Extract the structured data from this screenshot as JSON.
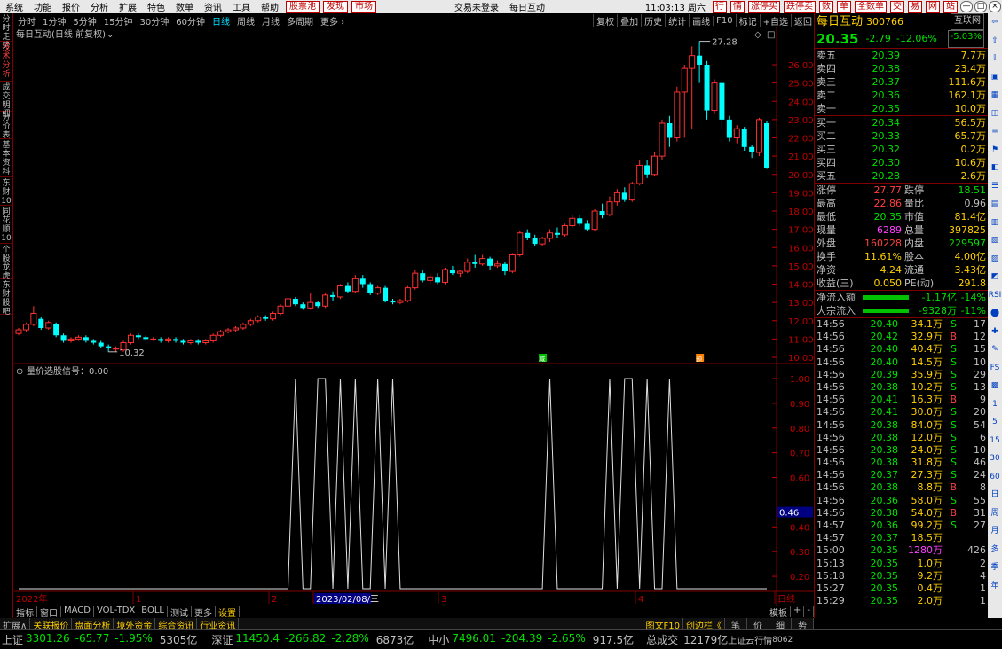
{
  "menu": {
    "items": [
      "系统",
      "功能",
      "报价",
      "分析",
      "扩展",
      "特色",
      "数单",
      "资讯",
      "工具",
      "帮助"
    ],
    "red_items": [
      "股票池",
      "发现",
      "市场"
    ],
    "center": "交易未登录",
    "stock": "每日互动",
    "time": "11:03:13 周六",
    "right_items": [
      "行",
      "情",
      "涨停买",
      "跌停卖",
      "数",
      "单",
      "全数单",
      "交",
      "易",
      "网",
      "站"
    ]
  },
  "periods": [
    "分时",
    "1分钟",
    "5分钟",
    "15分钟",
    "30分钟",
    "60分钟",
    "日线",
    "周线",
    "月线",
    "多周期",
    "更多 ›"
  ],
  "active_period": "日线",
  "tools": [
    "复权",
    "叠加",
    "历史",
    "统计",
    "画线",
    "F10",
    "标记",
    "+自选",
    "返回"
  ],
  "leftnav": [
    "分时走势",
    "技术分析",
    "成交明细",
    "分价表",
    "基本资料",
    "东财10",
    "同花顺10",
    "个股龙虎",
    "东财股吧"
  ],
  "chart_title": "每日互动(日线 前复权)",
  "chart_data": {
    "type": "candlestick",
    "price_axis": {
      "min": 10.0,
      "max": 26.0,
      "ticks": [
        "26.00",
        "25.00",
        "24.00",
        "23.00",
        "22.00",
        "21.00",
        "20.00",
        "19.00",
        "18.00",
        "17.00",
        "16.00",
        "15.00",
        "14.00",
        "13.00",
        "12.00",
        "11.00",
        "10.00"
      ]
    },
    "high_label": "27.28",
    "low_label": "10.32",
    "candles": [
      [
        11.3,
        11.5,
        11.2,
        11.6
      ],
      [
        11.5,
        11.8,
        11.4,
        11.9
      ],
      [
        11.8,
        12.4,
        11.7,
        12.8
      ],
      [
        12.1,
        11.6,
        11.5,
        12.2
      ],
      [
        11.6,
        11.9,
        11.5,
        12.0
      ],
      [
        11.8,
        11.2,
        11.1,
        11.9
      ],
      [
        11.2,
        10.9,
        10.8,
        11.3
      ],
      [
        10.9,
        11.0,
        10.8,
        11.1
      ],
      [
        11.0,
        11.1,
        10.9,
        11.2
      ],
      [
        11.1,
        10.9,
        10.8,
        11.2
      ],
      [
        10.9,
        10.8,
        10.7,
        11.0
      ],
      [
        10.8,
        10.6,
        10.5,
        10.9
      ],
      [
        10.6,
        10.5,
        10.3,
        10.7
      ],
      [
        10.5,
        10.5,
        10.3,
        10.6
      ],
      [
        10.4,
        10.8,
        10.3,
        10.9
      ],
      [
        10.8,
        11.2,
        10.7,
        11.3
      ],
      [
        11.2,
        11.1,
        11.0,
        11.3
      ],
      [
        11.1,
        11.0,
        10.9,
        11.2
      ],
      [
        11.0,
        11.0,
        10.9,
        11.1
      ],
      [
        11.0,
        10.9,
        10.8,
        11.1
      ],
      [
        10.9,
        11.0,
        10.8,
        11.1
      ],
      [
        11.0,
        10.9,
        10.8,
        11.1
      ],
      [
        10.9,
        10.8,
        10.7,
        11.0
      ],
      [
        10.8,
        10.9,
        10.7,
        11.0
      ],
      [
        10.9,
        10.8,
        10.7,
        11.0
      ],
      [
        10.8,
        10.9,
        10.7,
        11.0
      ],
      [
        10.9,
        11.2,
        10.8,
        11.3
      ],
      [
        11.2,
        11.4,
        11.1,
        11.5
      ],
      [
        11.4,
        11.5,
        11.3,
        11.6
      ],
      [
        11.5,
        11.6,
        11.4,
        11.7
      ],
      [
        11.6,
        11.8,
        11.5,
        11.9
      ],
      [
        11.8,
        12.0,
        11.7,
        12.1
      ],
      [
        12.0,
        12.2,
        11.9,
        12.3
      ],
      [
        12.2,
        12.1,
        12.0,
        12.3
      ],
      [
        12.1,
        12.4,
        12.0,
        12.5
      ],
      [
        12.4,
        12.8,
        12.3,
        12.9
      ],
      [
        12.8,
        13.2,
        12.7,
        13.3
      ],
      [
        13.2,
        12.9,
        12.8,
        13.3
      ],
      [
        12.9,
        12.7,
        12.6,
        13.0
      ],
      [
        12.7,
        13.0,
        12.6,
        13.5
      ],
      [
        13.0,
        12.8,
        12.7,
        13.1
      ],
      [
        12.8,
        13.4,
        12.7,
        13.5
      ],
      [
        13.4,
        13.3,
        13.1,
        13.6
      ],
      [
        13.3,
        13.9,
        13.2,
        14.0
      ],
      [
        13.9,
        13.6,
        13.5,
        14.1
      ],
      [
        13.6,
        14.3,
        13.5,
        14.5
      ],
      [
        14.3,
        14.0,
        13.8,
        14.5
      ],
      [
        14.0,
        13.5,
        13.4,
        14.1
      ],
      [
        13.5,
        13.8,
        13.4,
        13.9
      ],
      [
        13.8,
        13.1,
        13.0,
        13.9
      ],
      [
        13.1,
        13.0,
        12.9,
        13.2
      ],
      [
        13.0,
        13.1,
        12.9,
        13.2
      ],
      [
        13.1,
        13.8,
        13.0,
        13.9
      ],
      [
        13.8,
        14.6,
        13.7,
        14.8
      ],
      [
        14.6,
        14.2,
        14.1,
        14.8
      ],
      [
        14.2,
        14.4,
        14.0,
        14.6
      ],
      [
        14.4,
        14.1,
        14.0,
        14.6
      ],
      [
        14.1,
        14.8,
        14.0,
        14.9
      ],
      [
        14.8,
        14.6,
        14.5,
        15.0
      ],
      [
        14.6,
        14.7,
        14.4,
        14.8
      ],
      [
        14.7,
        15.2,
        14.6,
        15.4
      ],
      [
        15.2,
        15.1,
        14.9,
        15.6
      ],
      [
        15.1,
        15.4,
        15.0,
        15.6
      ],
      [
        15.4,
        15.0,
        14.8,
        15.5
      ],
      [
        15.0,
        15.1,
        14.9,
        15.3
      ],
      [
        15.1,
        14.7,
        14.5,
        15.2
      ],
      [
        14.7,
        15.6,
        14.6,
        15.7
      ],
      [
        15.6,
        16.8,
        15.5,
        16.9
      ],
      [
        16.8,
        16.5,
        16.4,
        17.0
      ],
      [
        16.5,
        16.2,
        16.1,
        16.7
      ],
      [
        16.2,
        16.5,
        16.1,
        16.6
      ],
      [
        16.5,
        16.8,
        16.3,
        17.0
      ],
      [
        16.8,
        16.7,
        16.5,
        17.1
      ],
      [
        16.7,
        17.2,
        16.6,
        17.3
      ],
      [
        17.2,
        17.6,
        17.1,
        17.8
      ],
      [
        17.6,
        17.3,
        17.2,
        17.8
      ],
      [
        17.3,
        17.0,
        16.9,
        17.5
      ],
      [
        17.0,
        18.0,
        16.9,
        18.1
      ],
      [
        18.0,
        17.8,
        17.6,
        18.4
      ],
      [
        17.8,
        18.5,
        17.7,
        18.8
      ],
      [
        18.5,
        19.0,
        18.3,
        19.2
      ],
      [
        19.0,
        18.6,
        18.5,
        19.3
      ],
      [
        18.6,
        19.5,
        18.5,
        19.6
      ],
      [
        19.5,
        20.5,
        19.4,
        20.8
      ],
      [
        20.5,
        20.0,
        19.8,
        20.8
      ],
      [
        20.0,
        21.0,
        19.9,
        21.2
      ],
      [
        21.0,
        22.8,
        20.8,
        23.0
      ],
      [
        22.8,
        22.0,
        21.5,
        23.2
      ],
      [
        22.0,
        24.5,
        21.8,
        24.8
      ],
      [
        24.5,
        25.8,
        22.0,
        26.0
      ],
      [
        25.8,
        26.5,
        22.5,
        27.0
      ],
      [
        26.5,
        26.0,
        25.0,
        27.28
      ],
      [
        26.0,
        23.5,
        23.0,
        26.2
      ],
      [
        23.5,
        25.0,
        23.3,
        25.2
      ],
      [
        25.0,
        23.0,
        22.5,
        25.1
      ],
      [
        23.0,
        22.0,
        21.8,
        23.2
      ],
      [
        22.0,
        22.5,
        21.7,
        22.7
      ],
      [
        22.5,
        21.5,
        21.3,
        22.6
      ],
      [
        21.5,
        21.2,
        20.9,
        21.6
      ],
      [
        21.2,
        23.0,
        21.0,
        23.1
      ],
      [
        22.8,
        20.35,
        20.3,
        22.9
      ]
    ],
    "indicator_title": "量价选股信号：0.00",
    "indicator_axis": {
      "ticks": [
        "1.00",
        "0.90",
        "0.80",
        "0.70",
        "0.60",
        "0.46",
        "0.40",
        "0.30",
        "0.20"
      ]
    },
    "signal_candles": [
      37,
      40,
      41,
      43,
      45,
      48,
      50,
      71,
      79,
      81,
      82,
      84,
      87
    ],
    "x_labels": [
      "2022年",
      "1",
      "2",
      "2023/02/08/三",
      "3",
      "4",
      "日线"
    ]
  },
  "quote": {
    "name": "每日互动",
    "code": "300766",
    "tag": "互联网",
    "price": "20.35",
    "change": "-2.79",
    "pct": "-12.06%",
    "small_pct": "-5.03%"
  },
  "asks": [
    [
      "卖五",
      "20.39",
      "7.7万"
    ],
    [
      "卖四",
      "20.38",
      "23.4万"
    ],
    [
      "卖三",
      "20.37",
      "111.6万"
    ],
    [
      "卖二",
      "20.36",
      "162.1万"
    ],
    [
      "卖一",
      "20.35",
      "10.0万"
    ]
  ],
  "bids": [
    [
      "买一",
      "20.34",
      "56.5万"
    ],
    [
      "买二",
      "20.33",
      "65.7万"
    ],
    [
      "买三",
      "20.32",
      "0.2万"
    ],
    [
      "买四",
      "20.30",
      "10.6万"
    ],
    [
      "买五",
      "20.28",
      "2.6万"
    ]
  ],
  "stats": [
    [
      "涨停",
      "27.77",
      "跌停",
      "18.51"
    ],
    [
      "最高",
      "22.86",
      "量比",
      "0.96"
    ],
    [
      "最低",
      "20.35",
      "市值",
      "81.4亿"
    ],
    [
      "现量",
      "6289",
      "总量",
      "397825"
    ],
    [
      "外盘",
      "160228",
      "内盘",
      "229597"
    ],
    [
      "换手",
      "11.61%",
      "股本",
      "4.00亿"
    ],
    [
      "净资",
      "4.24",
      "流通",
      "3.43亿"
    ],
    [
      "收益(三)",
      "0.050",
      "PE(动)",
      "291.8"
    ]
  ],
  "flows": [
    [
      "净流入额",
      "-1.17亿",
      "-14%"
    ],
    [
      "大宗流入",
      "-9328万",
      "-11%"
    ]
  ],
  "ticks": [
    [
      "14:56",
      "20.40",
      "34.1万",
      "S",
      "17"
    ],
    [
      "14:56",
      "20.42",
      "32.9万",
      "B",
      "12"
    ],
    [
      "14:56",
      "20.40",
      "40.4万",
      "S",
      "15"
    ],
    [
      "14:56",
      "20.40",
      "14.5万",
      "S",
      "10"
    ],
    [
      "14:56",
      "20.39",
      "35.9万",
      "S",
      "29"
    ],
    [
      "14:56",
      "20.38",
      "10.2万",
      "S",
      "13"
    ],
    [
      "14:56",
      "20.41",
      "16.3万",
      "B",
      "9"
    ],
    [
      "14:56",
      "20.41",
      "30.0万",
      "S",
      "20"
    ],
    [
      "14:56",
      "20.38",
      "84.0万",
      "S",
      "54"
    ],
    [
      "14:56",
      "20.38",
      "12.0万",
      "S",
      "6"
    ],
    [
      "14:56",
      "20.38",
      "24.0万",
      "S",
      "10"
    ],
    [
      "14:56",
      "20.38",
      "31.8万",
      "S",
      "46"
    ],
    [
      "14:56",
      "20.37",
      "27.3万",
      "S",
      "24"
    ],
    [
      "14:56",
      "20.38",
      "8.8万",
      "B",
      "8"
    ],
    [
      "14:56",
      "20.36",
      "58.0万",
      "S",
      "55"
    ],
    [
      "14:56",
      "20.38",
      "54.0万",
      "B",
      "31"
    ],
    [
      "14:57",
      "20.36",
      "99.2万",
      "S",
      "27"
    ],
    [
      "14:57",
      "20.37",
      "18.5万",
      "",
      ""
    ],
    [
      "15:00",
      "20.35",
      "1280万",
      "",
      "426"
    ],
    [
      "15:13",
      "20.35",
      "1.0万",
      "",
      "2"
    ],
    [
      "15:18",
      "20.35",
      "9.2万",
      "",
      "4"
    ],
    [
      "15:27",
      "20.35",
      "0.4万",
      "",
      "1"
    ],
    [
      "15:29",
      "20.35",
      "2.0万",
      "",
      "1"
    ]
  ],
  "rtoolbar": [
    "⇦",
    "⇧",
    "⇩",
    "▣",
    "▦",
    "◫",
    "≡",
    "⚑",
    "◧",
    "☰",
    "▤",
    "▥",
    "▧",
    "▨",
    "◩",
    "RSI",
    "⬤",
    "✚",
    "✎",
    "FS",
    "▩",
    "1",
    "5",
    "15",
    "30",
    "60",
    "日",
    "周",
    "月",
    "多",
    "季",
    "年"
  ],
  "bottomtabs": [
    "指标",
    "窗口",
    "MACD",
    "VOL-TDX",
    "BOLL",
    "测试",
    "更多",
    "设置"
  ],
  "bottom_right": [
    "模板",
    "+",
    "-"
  ],
  "extbar": [
    "扩展∧",
    "关联报价",
    "盘面分析",
    "境外资金",
    "综合资讯",
    "行业资讯"
  ],
  "extbar_right": [
    "图文F10",
    "创边栏《",
    "笔",
    "价",
    "细",
    "势"
  ],
  "status": [
    [
      "上证",
      "3301.26",
      "-65.77",
      "-1.95%",
      "5305亿"
    ],
    [
      "深证",
      "11450.4",
      "-266.82",
      "-2.28%",
      "6873亿"
    ],
    [
      "中小",
      "7496.01",
      "-204.39",
      "-2.65%",
      "917.5亿"
    ]
  ],
  "status_tail": [
    "总成交",
    "12179亿",
    "上证云行情",
    "8062"
  ]
}
